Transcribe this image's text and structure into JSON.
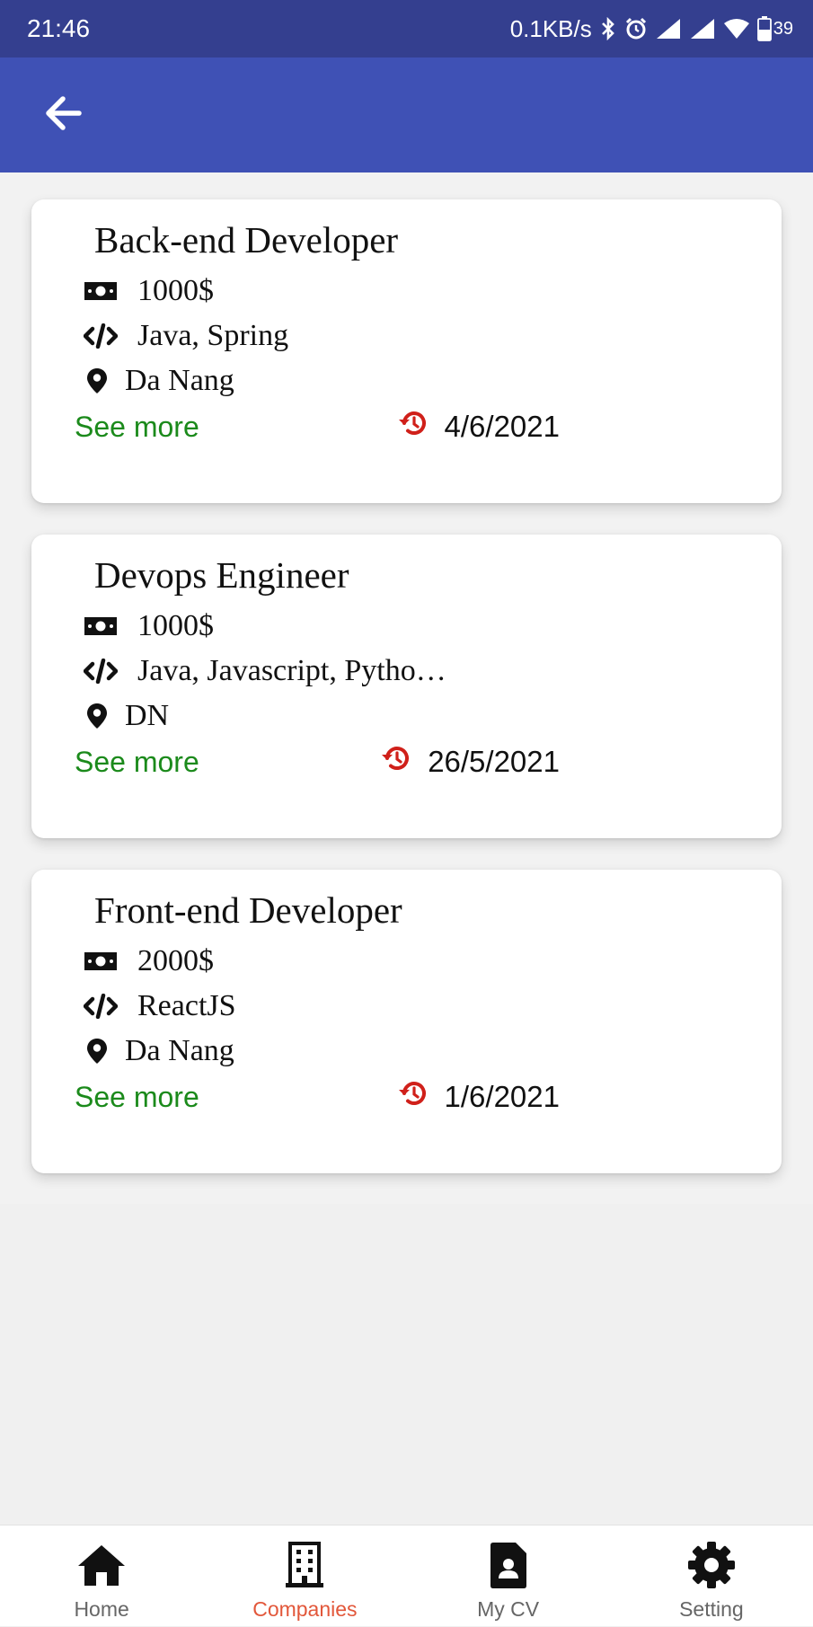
{
  "status_bar": {
    "time": "21:46",
    "network_speed": "0.1KB/s",
    "battery_level": "39",
    "icons": [
      "bluetooth-icon",
      "alarm-icon",
      "signal-icon",
      "signal-icon",
      "wifi-icon",
      "battery-icon"
    ]
  },
  "app_bar": {
    "back_icon": "arrow-left-icon",
    "background_color": "#3f51b5"
  },
  "jobs": [
    {
      "title": "Back-end Developer",
      "salary": "1000$",
      "skills": "Java, Spring",
      "location": "Da Nang",
      "see_more_label": "See more",
      "date": "4/6/2021"
    },
    {
      "title": "Devops Engineer",
      "salary": "1000$",
      "skills": "Java, Javascript, Pytho…",
      "location": "DN",
      "see_more_label": "See more",
      "date": "26/5/2021"
    },
    {
      "title": "Front-end Developer",
      "salary": "2000$",
      "skills": "ReactJS",
      "location": "Da Nang",
      "see_more_label": "See more",
      "date": "1/6/2021"
    }
  ],
  "bottom_nav": {
    "active": "Companies",
    "active_color": "#e2573a",
    "items": [
      {
        "label": "Home",
        "icon": "home-icon"
      },
      {
        "label": "Companies",
        "icon": "building-icon"
      },
      {
        "label": "My CV",
        "icon": "cv-document-icon"
      },
      {
        "label": "Setting",
        "icon": "gear-icon"
      }
    ]
  },
  "colors": {
    "status_bar": "#343f8f",
    "see_more": "#1b8a1b",
    "date_icon": "#d0201a"
  }
}
